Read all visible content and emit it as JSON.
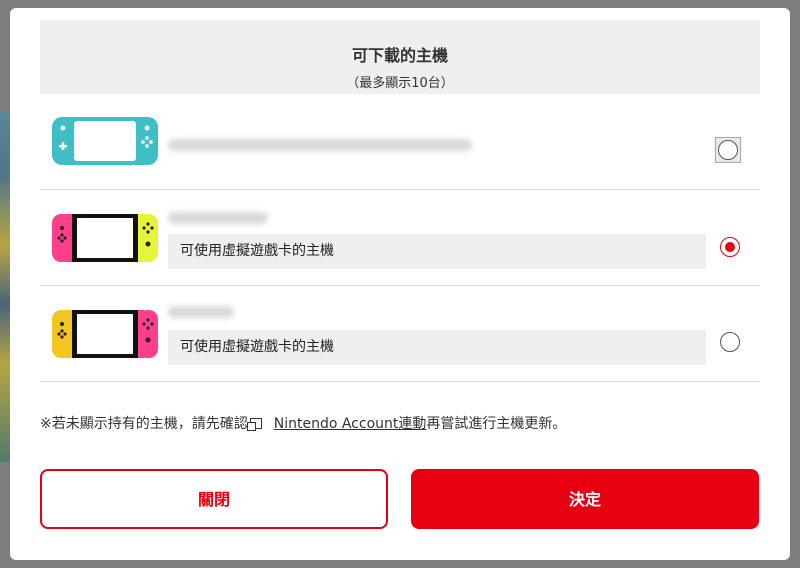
{
  "dialog": {
    "title": "可下載的主機",
    "subtitle": "（最多顯示10台）"
  },
  "consoles": [
    {
      "icon": "switch-lite-turquoise-icon",
      "tag": "",
      "selected": false
    },
    {
      "icon": "switch-neon-pink-yellow-icon",
      "tag": "可使用虛擬遊戲卡的主機",
      "selected": true
    },
    {
      "icon": "switch-neon-yellow-pink-icon",
      "tag": "可使用虛擬遊戲卡的主機",
      "selected": false
    }
  ],
  "note": {
    "prefix": "※若未顯示持有的主機，請先確認",
    "link": "Nintendo Account連動",
    "suffix": "再嘗試進行主機更新。"
  },
  "buttons": {
    "close": "關閉",
    "confirm": "決定"
  },
  "colors": {
    "accent": "#e60012",
    "header_bg": "#efefef",
    "lite_turquoise": "#3fbfc5",
    "neon_pink": "#ff3f8c",
    "neon_yellow": "#e6f53a",
    "neon_yellow2": "#f2c521"
  }
}
